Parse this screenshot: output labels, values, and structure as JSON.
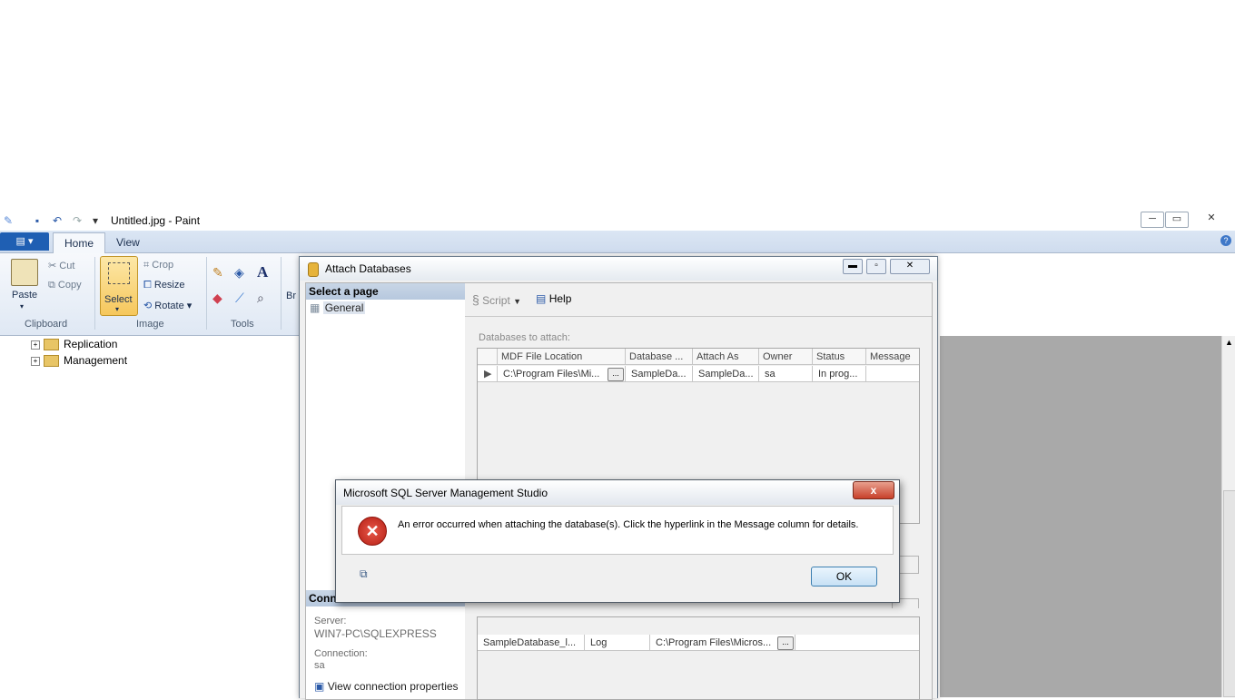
{
  "paint": {
    "title": "Untitled.jpg - Paint",
    "tabs": [
      "Home",
      "View"
    ],
    "clipboard": {
      "paste": "Paste",
      "cut": "Cut",
      "copy": "Copy",
      "label": "Clipboard"
    },
    "image": {
      "select": "Select",
      "crop": "Crop",
      "resize": "Resize",
      "rotate": "Rotate",
      "label": "Image"
    },
    "tools": {
      "label": "Tools",
      "text_tool": "A"
    },
    "brushes_partial": "Br"
  },
  "tree": {
    "items": [
      "Replication",
      "Management"
    ]
  },
  "attach": {
    "title": "Attach Databases",
    "select_page": "Select a page",
    "page_general": "General",
    "toolbar": {
      "script": "Script",
      "help": "Help"
    },
    "databases_label": "Databases to attach:",
    "columns": [
      "MDF File Location",
      "Database ...",
      "Attach As",
      "Owner",
      "Status",
      "Message"
    ],
    "row": [
      "C:\\Program Files\\Mi...",
      "SampleDa...",
      "SampleDa...",
      "sa",
      "In prog...",
      ""
    ],
    "connection_head": "Conn",
    "server_label": "Server:",
    "server_value": "WIN7-PC\\SQLEXPRESS",
    "connection_label": "Connection:",
    "connection_value": "sa",
    "view_connection": "View connection properties",
    "detail_row": [
      "SampleDatabase_l...",
      "Log",
      "C:\\Program Files\\Micros..."
    ]
  },
  "msgbox": {
    "title": "Microsoft SQL Server Management Studio",
    "message": "An error occurred when attaching the database(s).  Click the hyperlink in the Message column for details.",
    "ok": "OK",
    "close": "x"
  },
  "colors": {
    "accent": "#1f5fb3",
    "error": "#c8302a",
    "swatches": [
      "#000000",
      "#7f7f7f",
      "#880015",
      "#ed1c24",
      "#ff7f27",
      "#fff200",
      "#22b14c",
      "#00a2e8",
      "#3f48cc",
      "#a349a4"
    ]
  }
}
